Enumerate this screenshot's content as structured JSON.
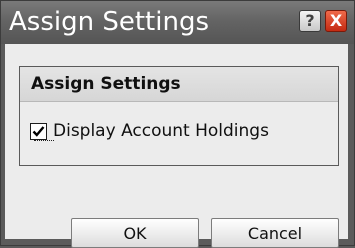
{
  "window": {
    "title": "Assign Settings",
    "help_glyph": "?",
    "close_glyph": "X"
  },
  "group": {
    "title": "Assign Settings",
    "checkbox_label": "Display Account Holdings",
    "checkbox_checked": true
  },
  "buttons": {
    "ok_label": "OK",
    "cancel_label": "Cancel"
  },
  "colors": {
    "titlebar": "#646464",
    "close_button": "#d8401f",
    "client_background": "#ececec"
  },
  "icons": {
    "help": "help-icon",
    "close": "close-icon",
    "check": "checkmark-icon"
  }
}
